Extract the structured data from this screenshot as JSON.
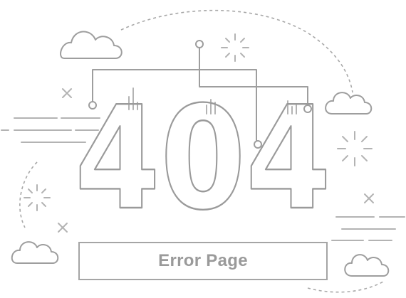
{
  "error_code": "404",
  "error_label": "Error Page"
}
